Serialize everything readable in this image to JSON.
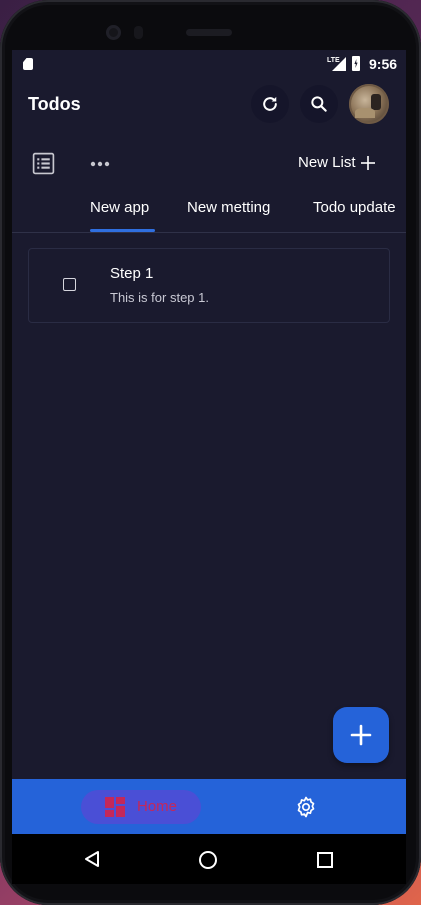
{
  "status_bar": {
    "network": "LTE",
    "time": "9:56"
  },
  "app_bar": {
    "title": "Todos",
    "icons": [
      "refresh-icon",
      "search-icon",
      "avatar"
    ]
  },
  "toolbar": {
    "new_list_label": "New List",
    "icons": [
      "list-view-icon",
      "more-horizontal-icon",
      "plus-icon"
    ]
  },
  "tabs": [
    {
      "label": "New app",
      "selected": true
    },
    {
      "label": "New metting",
      "selected": false
    },
    {
      "label": "Todo update",
      "selected": false
    }
  ],
  "todos": [
    {
      "title": "Step 1",
      "description": "This is for step 1.",
      "checked": false
    }
  ],
  "bottom_nav": {
    "items": [
      {
        "label": "Home",
        "icon": "dashboard-icon",
        "selected": true
      },
      {
        "label": "",
        "icon": "settings-icon",
        "selected": false
      }
    ]
  },
  "colors": {
    "background": "#1a1a2e",
    "accent": "#2563d9",
    "home_label": "#c4285a"
  }
}
